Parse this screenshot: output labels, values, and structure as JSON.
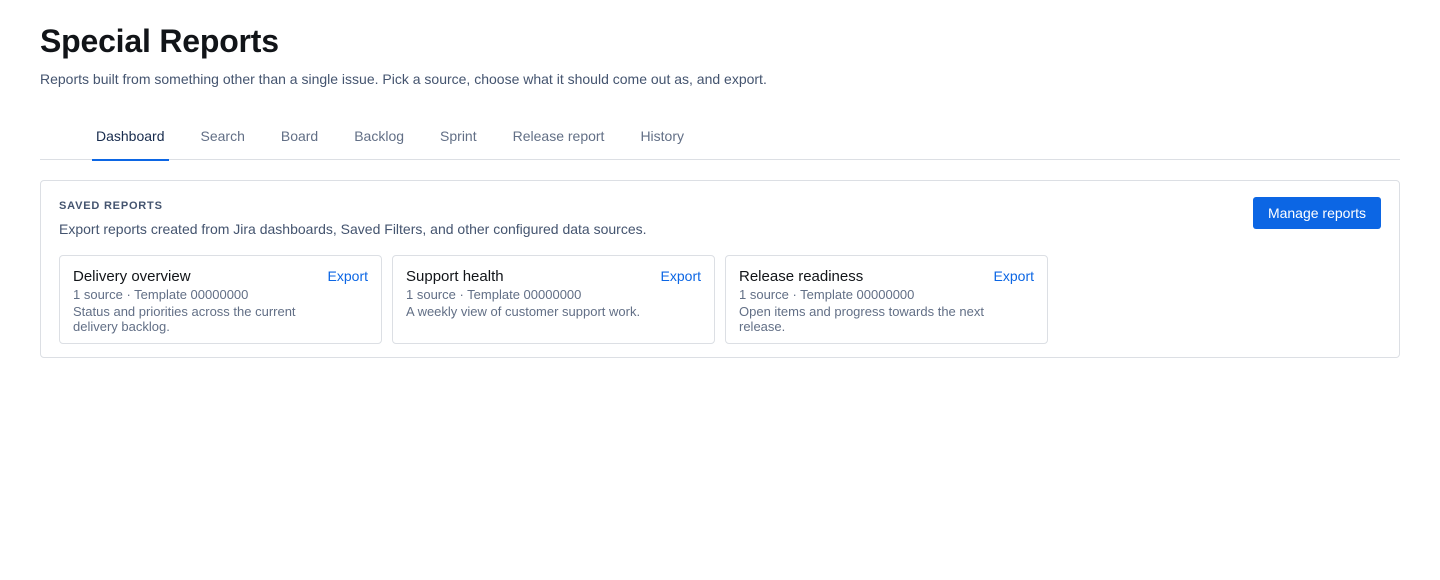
{
  "header": {
    "title": "Special Reports",
    "subtitle": "Reports built from something other than a single issue. Pick a source, choose what it should come out as, and export."
  },
  "tabs": [
    {
      "label": "Dashboard",
      "active": true
    },
    {
      "label": "Search",
      "active": false
    },
    {
      "label": "Board",
      "active": false
    },
    {
      "label": "Backlog",
      "active": false
    },
    {
      "label": "Sprint",
      "active": false
    },
    {
      "label": "Release report",
      "active": false
    },
    {
      "label": "History",
      "active": false
    }
  ],
  "saved_reports": {
    "heading": "SAVED REPORTS",
    "description": "Export reports created from Jira dashboards, Saved Filters, and other configured data sources.",
    "manage_label": "Manage reports",
    "cards": [
      {
        "title": "Delivery overview",
        "export_label": "Export",
        "meta": "1 source · Template 00000000",
        "description": "Status and priorities across the current delivery backlog."
      },
      {
        "title": "Support health",
        "export_label": "Export",
        "meta": "1 source · Template 00000000",
        "description": "A weekly view of customer support work."
      },
      {
        "title": "Release readiness",
        "export_label": "Export",
        "meta": "1 source · Template 00000000",
        "description": "Open items and progress towards the next release."
      }
    ]
  },
  "colors": {
    "accent": "#0c66e4",
    "text_primary": "#111418",
    "text_secondary": "#626f86",
    "border": "#dcdfe4"
  }
}
